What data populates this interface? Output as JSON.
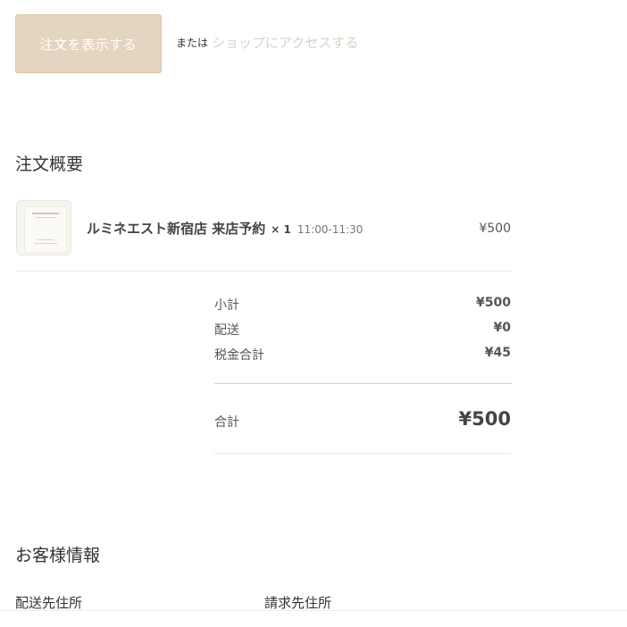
{
  "actions": {
    "view_order_label": "注文を表示する",
    "or_text": "または",
    "shop_link_label": "ショップにアクセスする"
  },
  "summary": {
    "title": "注文概要",
    "item": {
      "name": "ルミネエスト新宿店 来店予約",
      "quantity": "× 1",
      "time": "11:00-11:30",
      "price": "¥500"
    },
    "totals": {
      "subtotal_label": "小計",
      "subtotal_value": "¥500",
      "shipping_label": "配送",
      "shipping_value": "¥0",
      "tax_label": "税金合計",
      "tax_value": "¥45",
      "total_label": "合計",
      "total_value": "¥500"
    }
  },
  "customer": {
    "title": "お客様情報",
    "shipping_address_label": "配送先住所",
    "billing_address_label": "請求先住所"
  },
  "colors": {
    "button_bg": "#e4d5c0",
    "link": "#d9d2c8"
  }
}
